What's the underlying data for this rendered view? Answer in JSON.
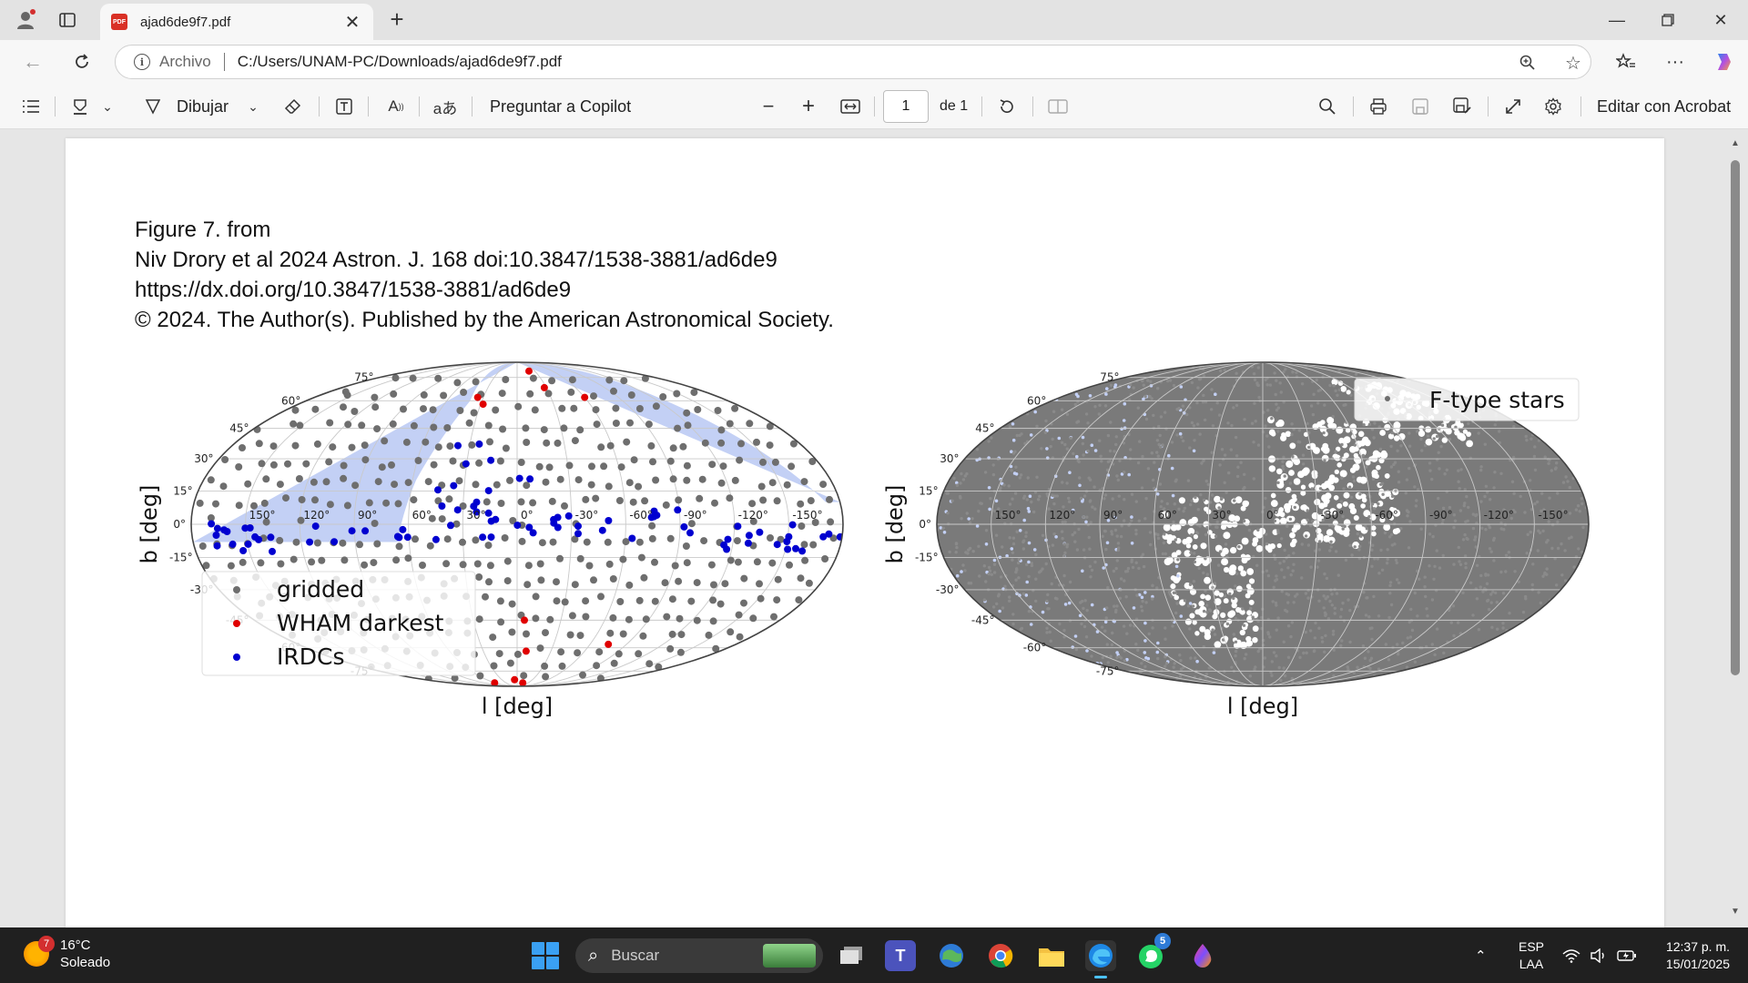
{
  "browser": {
    "tab_title": "ajad6de9f7.pdf",
    "pdf_badge": "PDF",
    "address_label": "Archivo",
    "url": "C:/Users/UNAM-PC/Downloads/ajad6de9f7.pdf"
  },
  "toolbar": {
    "draw_label": "Dibujar",
    "copilot_label": "Preguntar a Copilot",
    "page_current": "1",
    "page_total": "de 1",
    "acrobat_label": "Editar con Acrobat"
  },
  "document": {
    "caption_lines": [
      "Figure 7. from",
      "Niv Drory et al 2024 Astron. J. 168 doi:10.3847/1538-3881/ad6de9",
      "https://dx.doi.org/10.3847/1538-3881/ad6de9",
      "© 2024. The Author(s). Published by the American Astronomical Society."
    ]
  },
  "chart_data": [
    {
      "type": "scatter",
      "projection": "mollweide",
      "xlabel": "l [deg]",
      "ylabel": "b [deg]",
      "lon_tick_labels": [
        "150°",
        "120°",
        "90°",
        "60°",
        "30°",
        "0°",
        "-30°",
        "-60°",
        "-90°",
        "-120°",
        "-150°"
      ],
      "lat_tick_labels": [
        "75°",
        "60°",
        "45°",
        "30°",
        "15°",
        "0°",
        "-15°",
        "-30°",
        "-45°",
        "-60°",
        "-75°"
      ],
      "legend_position": "lower-left",
      "series": [
        {
          "name": "gridded",
          "color": "#6e6e6e"
        },
        {
          "name": "WHAM darkest",
          "color": "#e00000"
        },
        {
          "name": "IRDCs",
          "color": "#0000d0"
        }
      ],
      "shaded_region_color": "#c3d0f5"
    },
    {
      "type": "scatter",
      "projection": "mollweide",
      "xlabel": "l [deg]",
      "ylabel": "b [deg]",
      "lon_tick_labels": [
        "150°",
        "120°",
        "90°",
        "60°",
        "30°",
        "0°",
        "-30°",
        "-60°",
        "-90°",
        "-120°",
        "-150°"
      ],
      "lat_tick_labels": [
        "75°",
        "60°",
        "45°",
        "30°",
        "15°",
        "0°",
        "-15°",
        "-30°",
        "-45°",
        "-60°",
        "-75°"
      ],
      "legend_position": "top-right",
      "series": [
        {
          "name": "F-type stars",
          "color": "#6e6e6e"
        }
      ],
      "shaded_region_color": "#c3d0f5"
    }
  ],
  "taskbar": {
    "temperature": "16°C",
    "weather": "Soleado",
    "weather_badge": "7",
    "search_placeholder": "Buscar",
    "whatsapp_badge": "5",
    "lang_top": "ESP",
    "lang_bottom": "LAA",
    "time": "12:37 p. m.",
    "date": "15/01/2025"
  }
}
